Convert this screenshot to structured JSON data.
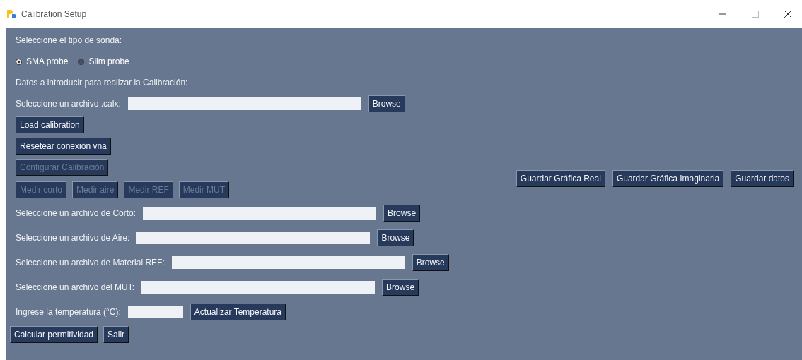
{
  "window": {
    "title": "Calibration Setup"
  },
  "probe_label": "Seleccione el tipo de sonda:",
  "probes": [
    {
      "label": "SMA probe",
      "selected": true
    },
    {
      "label": "Slim probe",
      "selected": false
    }
  ],
  "instructions": "Datos a introducir para realizar la Calibración:",
  "calx_file": {
    "label": "Seleccione un archivo .calx:",
    "browse": "Browse"
  },
  "actions": [
    {
      "label": "Load calibration",
      "disabled": false
    },
    {
      "label": "Resetear conexión vna",
      "disabled": false
    },
    {
      "label": "Configurar Calibración",
      "disabled": true
    }
  ],
  "measure_buttons": [
    {
      "label": "Medir corto",
      "disabled": true
    },
    {
      "label": "Medir aire",
      "disabled": true
    },
    {
      "label": "Medir REF",
      "disabled": true
    },
    {
      "label": "Medir MUT",
      "disabled": true
    }
  ],
  "save_buttons": [
    {
      "label": "Guardar Gráfica Real",
      "disabled": false
    },
    {
      "label": "Guardar Gráfica Imaginaria",
      "disabled": false
    },
    {
      "label": "Guardar datos",
      "disabled": false
    }
  ],
  "file_rows": [
    {
      "label": "Seleccione un archivo de Corto:",
      "browse": "Browse"
    },
    {
      "label": "Seleccione un archivo de Aire:",
      "browse": "Browse"
    },
    {
      "label": "Seleccione un archivo de Material REF:",
      "browse": "Browse"
    },
    {
      "label": "Seleccione un archivo del MUT:",
      "browse": "Browse"
    }
  ],
  "temperature": {
    "label": "Ingrese la temperatura (°C):",
    "button": "Actualizar Temperatura"
  },
  "bottom_buttons": [
    {
      "label": "Calcular permitividad",
      "disabled": false
    },
    {
      "label": "Salir",
      "disabled": false
    }
  ]
}
